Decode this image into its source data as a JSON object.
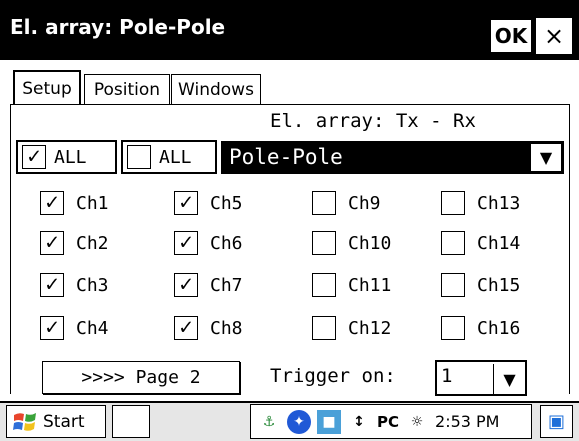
{
  "window": {
    "title": "El. array: Pole-Pole",
    "ok_label": "OK",
    "close_glyph": "×"
  },
  "tabs": [
    {
      "label": "Setup",
      "active": true
    },
    {
      "label": "Position",
      "active": false
    },
    {
      "label": "Windows",
      "active": false
    }
  ],
  "setup": {
    "array_label": "El. array: Tx - Rx",
    "all_checked": {
      "label": "ALL",
      "checked": true
    },
    "all_unchecked": {
      "label": "ALL",
      "checked": false
    },
    "array_select": {
      "value": "Pole-Pole",
      "arrow": "▼"
    },
    "channels": [
      {
        "label": "Ch1",
        "checked": true
      },
      {
        "label": "Ch5",
        "checked": true
      },
      {
        "label": "Ch9",
        "checked": false
      },
      {
        "label": "Ch13",
        "checked": false
      },
      {
        "label": "Ch2",
        "checked": true
      },
      {
        "label": "Ch6",
        "checked": true
      },
      {
        "label": "Ch10",
        "checked": false
      },
      {
        "label": "Ch14",
        "checked": false
      },
      {
        "label": "Ch3",
        "checked": true
      },
      {
        "label": "Ch7",
        "checked": true
      },
      {
        "label": "Ch11",
        "checked": false
      },
      {
        "label": "Ch15",
        "checked": false
      },
      {
        "label": "Ch4",
        "checked": true
      },
      {
        "label": "Ch8",
        "checked": true
      },
      {
        "label": "Ch12",
        "checked": false
      },
      {
        "label": "Ch16",
        "checked": false
      }
    ],
    "page_button_label": ">>>> Page 2",
    "trigger_label": "Trigger on:",
    "trigger_value": "1",
    "trigger_arrow": "▼"
  },
  "taskbar": {
    "start_label": "Start",
    "start_icon": "windows-flag-icon",
    "tray_pc_label": "PC",
    "tray_time": "2:53 PM",
    "check_mark": "✓"
  }
}
